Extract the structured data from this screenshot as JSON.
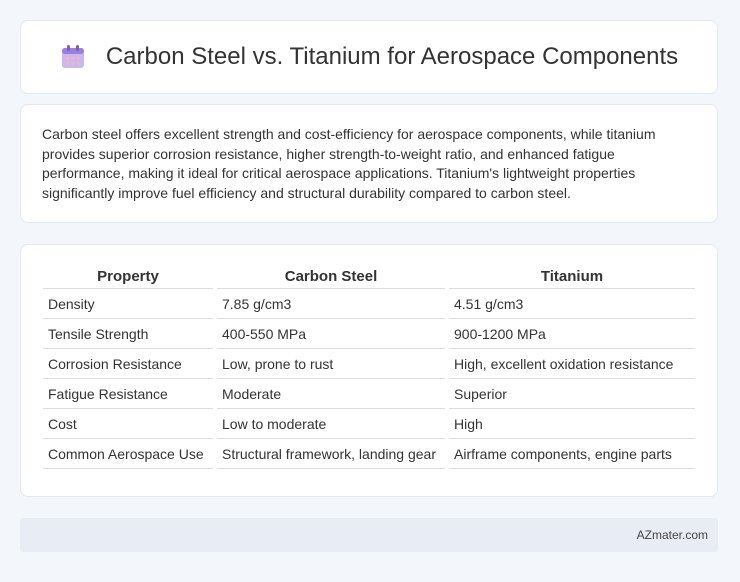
{
  "header": {
    "title": "Carbon Steel vs. Titanium for Aerospace Components",
    "icon": "calendar-icon"
  },
  "summary": {
    "text": "Carbon steel offers excellent strength and cost-efficiency for aerospace components, while titanium provides superior corrosion resistance, higher strength-to-weight ratio, and enhanced fatigue performance, making it ideal for critical aerospace applications. Titanium's lightweight properties significantly improve fuel efficiency and structural durability compared to carbon steel."
  },
  "table": {
    "headers": [
      "Property",
      "Carbon Steel",
      "Titanium"
    ],
    "rows": [
      [
        "Density",
        "7.85 g/cm3",
        "4.51 g/cm3"
      ],
      [
        "Tensile Strength",
        "400-550 MPa",
        "900-1200 MPa"
      ],
      [
        "Corrosion Resistance",
        "Low, prone to rust",
        "High, excellent oxidation resistance"
      ],
      [
        "Fatigue Resistance",
        "Moderate",
        "Superior"
      ],
      [
        "Cost",
        "Low to moderate",
        "High"
      ],
      [
        "Common Aerospace Use",
        "Structural framework, landing gear",
        "Airframe components, engine parts"
      ]
    ]
  },
  "footer": {
    "text": "AZmater.com"
  },
  "colors": {
    "background": "#f3f6fa",
    "card": "#ffffff",
    "footer": "#e8edf5",
    "icon_accent": "#a78bdb"
  }
}
